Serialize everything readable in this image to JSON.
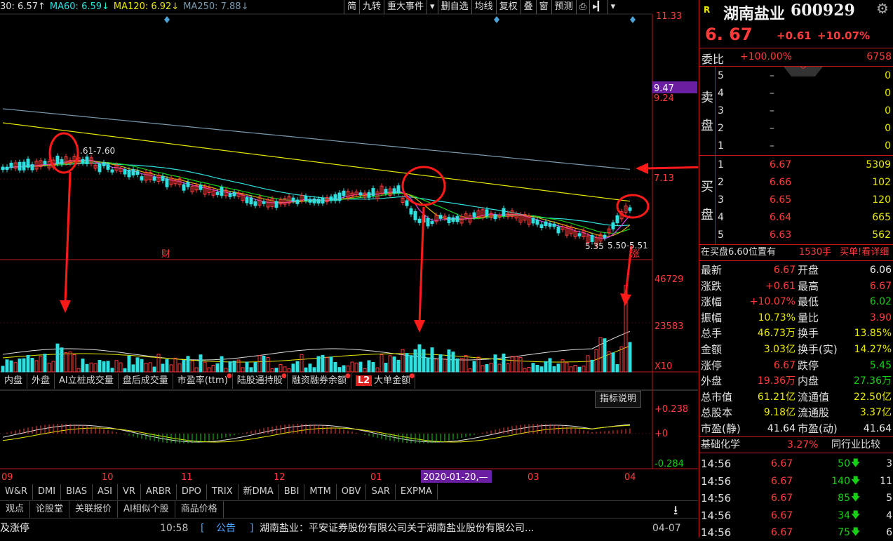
{
  "ma_legend": [
    {
      "label": "30: 6.57↑",
      "color": "#e0e0e0"
    },
    {
      "label": "MA60: 6.59↓",
      "color": "#2ee0e0"
    },
    {
      "label": "MA120: 6.92↓",
      "color": "#e8e800"
    },
    {
      "label": "MA250: 7.88↓",
      "color": "#7a9ab0"
    }
  ],
  "toolbar": [
    "简",
    "九转",
    "重大事件",
    "▾",
    "删自选",
    "均线",
    "复权",
    "叠",
    "窗",
    "预测",
    "⎙",
    "▸▎",
    "▾"
  ],
  "price_axis": {
    "top": "11.33",
    "mark_purple": "9.47",
    "mark2": "9.24",
    "mid": "7.13"
  },
  "annotations": {
    "range1": ".61-7.60",
    "low": "5.35",
    "range2": "5.50-5.51",
    "cai": "财",
    "zhang": "涨"
  },
  "vol_axis": {
    "v1": "46729",
    "v2": "23583",
    "unit": "X10"
  },
  "tabs_row": [
    {
      "label": "内盘",
      "dot": false
    },
    {
      "label": "外盘",
      "dot": false
    },
    {
      "label": "AI立桩成交量",
      "dot": false
    },
    {
      "label": "盘后成交量",
      "dot": false
    },
    {
      "label": "市盈率(ttm)",
      "dot": true
    },
    {
      "label": "陆股通持股",
      "dot": true
    },
    {
      "label": "融资融券余额",
      "dot": true
    },
    {
      "label": "大单金额",
      "dot": true,
      "badge": "L2"
    }
  ],
  "indicator_help": "指标说明",
  "macd_axis": {
    "top": "+0.238",
    "zero": "+0",
    "bottom": "-0.284"
  },
  "x_axis": {
    "m09": "09",
    "m10": "10",
    "m11": "11",
    "m12": "12",
    "m01": "01",
    "date": "2020-01-20,—",
    "m03": "03",
    "m04": "04"
  },
  "indicator_tabs": [
    "W&R",
    "DMI",
    "BIAS",
    "ASI",
    "VR",
    "ARBR",
    "DPO",
    "TRIX",
    "新DMA",
    "BBI",
    "MTM",
    "OBV",
    "SAR",
    "EXPMA"
  ],
  "news_tabs": [
    "观点",
    "论股堂",
    "关联报价",
    "AI相似个股",
    "商品价格"
  ],
  "download_icon": "⭳",
  "ticker": {
    "left": "及涨停",
    "time": "10:58",
    "bracket": "[",
    "tag": "公告",
    "sep": "]",
    "text": "湖南盐业：平安证券股份有限公司关于湖南盐业股份有限公司...",
    "date": "04-07"
  },
  "stock": {
    "r_badge": "R",
    "name": "湖南盐业",
    "code": "600929",
    "price": "6. 67",
    "change": "+0.61",
    "pct": "+10.07%"
  },
  "weibi": {
    "label": "委比",
    "value": "+100.00%",
    "diff": "6758"
  },
  "sell_label": [
    "卖",
    "盘"
  ],
  "buy_label": [
    "买",
    "盘"
  ],
  "sell": [
    {
      "lvl": "5",
      "price": "–",
      "vol": "0"
    },
    {
      "lvl": "4",
      "price": "–",
      "vol": "0"
    },
    {
      "lvl": "3",
      "price": "–",
      "vol": "0"
    },
    {
      "lvl": "2",
      "price": "–",
      "vol": "0"
    },
    {
      "lvl": "1",
      "price": "–",
      "vol": "0"
    }
  ],
  "buy": [
    {
      "lvl": "1",
      "price": "6.67",
      "vol": "5309"
    },
    {
      "lvl": "2",
      "price": "6.66",
      "vol": "102"
    },
    {
      "lvl": "3",
      "price": "6.65",
      "vol": "120"
    },
    {
      "lvl": "4",
      "price": "6.64",
      "vol": "665"
    },
    {
      "lvl": "5",
      "price": "6.63",
      "vol": "562"
    }
  ],
  "bid_info": {
    "text": "在买盘6.60位置有",
    "qty": "1530手",
    "link": "买单!看详细"
  },
  "stats": [
    {
      "l1": "最新",
      "v1": "6.67",
      "c1": "red",
      "l2": "开盘",
      "v2": "6.06",
      "c2": "white"
    },
    {
      "l1": "涨跌",
      "v1": "+0.61",
      "c1": "red",
      "l2": "最高",
      "v2": "6.67",
      "c2": "red"
    },
    {
      "l1": "涨幅",
      "v1": "+10.07%",
      "c1": "red",
      "l2": "最低",
      "v2": "6.02",
      "c2": "green"
    },
    {
      "l1": "振幅",
      "v1": "10.73%",
      "c1": "yellow",
      "l2": "量比",
      "v2": "3.90",
      "c2": "red"
    },
    {
      "l1": "总手",
      "v1": "46.73万",
      "c1": "yellow",
      "l2": "换手",
      "v2": "13.85%",
      "c2": "yellow"
    },
    {
      "l1": "金额",
      "v1": "3.03亿",
      "c1": "yellow",
      "l2": "换手(实)",
      "v2": "14.27%",
      "c2": "yellow"
    },
    {
      "l1": "涨停",
      "v1": "6.67",
      "c1": "red",
      "l2": "跌停",
      "v2": "5.45",
      "c2": "green"
    },
    {
      "l1": "外盘",
      "v1": "19.36万",
      "c1": "red",
      "l2": "内盘",
      "v2": "27.36万",
      "c2": "green"
    },
    {
      "l1": "总市值",
      "v1": "61.21亿",
      "c1": "yellow",
      "l2": "流通值",
      "v2": "22.50亿",
      "c2": "yellow"
    },
    {
      "l1": "总股本",
      "v1": "9.18亿",
      "c1": "yellow",
      "l2": "流通股",
      "v2": "3.37亿",
      "c2": "yellow"
    },
    {
      "l1": "市盈(静)",
      "v1": "41.64",
      "c1": "white",
      "l2": "市盈(动)",
      "v2": "41.64",
      "c2": "white"
    }
  ],
  "sector": {
    "name": "基础化学",
    "pct": "3.27%",
    "link": "同行业比较"
  },
  "trades": [
    {
      "t": "14:56",
      "p": "6.67",
      "v": "50",
      "n": "3"
    },
    {
      "t": "14:56",
      "p": "6.67",
      "v": "140",
      "n": "11"
    },
    {
      "t": "14:56",
      "p": "6.67",
      "v": "85",
      "n": "5"
    },
    {
      "t": "14:56",
      "p": "6.67",
      "v": "34",
      "n": "4"
    },
    {
      "t": "14:56",
      "p": "6.67",
      "v": "75",
      "n": "6"
    }
  ]
}
